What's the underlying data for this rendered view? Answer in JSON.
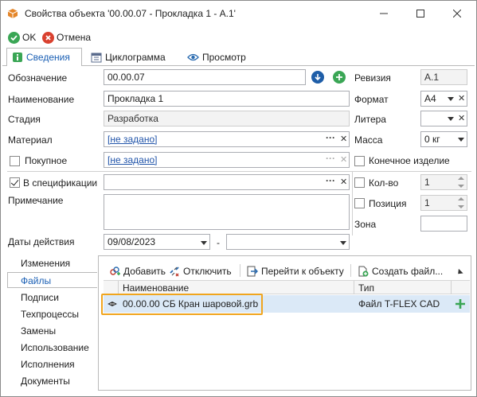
{
  "window": {
    "title": "Свойства объекта '00.00.07 - Прокладка 1 - А.1'"
  },
  "actions": {
    "ok": "OK",
    "cancel": "Отмена"
  },
  "tabs": [
    {
      "label": "Сведения",
      "icon": "info-icon"
    },
    {
      "label": "Циклограмма",
      "icon": "calendar-icon"
    },
    {
      "label": "Просмотр",
      "icon": "eye-icon"
    }
  ],
  "form": {
    "designation": {
      "label": "Обозначение",
      "value": "00.00.07"
    },
    "name": {
      "label": "Наименование",
      "value": "Прокладка 1"
    },
    "stage": {
      "label": "Стадия",
      "value": "Разработка"
    },
    "material": {
      "label": "Материал",
      "value": "[не задано]"
    },
    "purchased": {
      "label": "Покупное",
      "value": "[не задано]",
      "checked": false
    },
    "in_spec": {
      "label": "В спецификации",
      "checked": true,
      "value": ""
    },
    "note": {
      "label": "Примечание",
      "value": ""
    },
    "dates": {
      "label": "Даты действия",
      "from": "09/08/2023",
      "separator": "-",
      "to": ""
    },
    "revision": {
      "label": "Ревизия",
      "value": "А.1"
    },
    "format": {
      "label": "Формат",
      "value": "А4"
    },
    "litera": {
      "label": "Литера",
      "value": ""
    },
    "mass": {
      "label": "Масса",
      "value": "0 кг"
    },
    "final_product": {
      "label": "Конечное изделие",
      "checked": false
    },
    "quantity": {
      "label": "Кол-во",
      "value": "1",
      "checked": false
    },
    "position": {
      "label": "Позиция",
      "value": "1",
      "checked": false
    },
    "zone": {
      "label": "Зона",
      "value": ""
    }
  },
  "sidenav": [
    {
      "label": "Изменения",
      "active": false
    },
    {
      "label": "Файлы",
      "active": true
    },
    {
      "label": "Подписи",
      "active": false
    },
    {
      "label": "Техпроцессы",
      "active": false
    },
    {
      "label": "Замены",
      "active": false
    },
    {
      "label": "Использование",
      "active": false
    },
    {
      "label": "Исполнения",
      "active": false
    },
    {
      "label": "Документы",
      "active": false
    }
  ],
  "files": {
    "toolbar": {
      "add": "Добавить",
      "detach": "Отключить",
      "goto": "Перейти к объекту",
      "create": "Создать файл..."
    },
    "columns": {
      "name": "Наименование",
      "type": "Тип"
    },
    "rows": [
      {
        "name": "00.00.00 СБ Кран шаровой.grb",
        "type": "Файл T-FLEX CAD"
      }
    ]
  },
  "colors": {
    "accent": "#1a5fb4",
    "highlight": "#f0a51e",
    "ok_green": "#3aa655",
    "cancel_red": "#d9412f"
  }
}
